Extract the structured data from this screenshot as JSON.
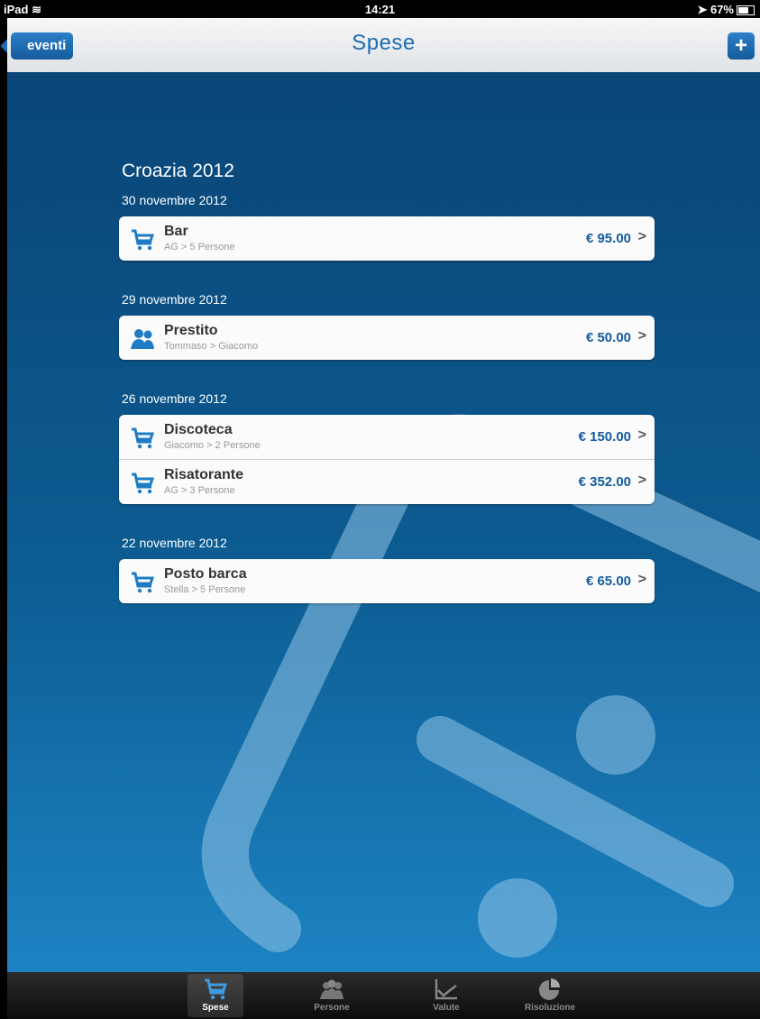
{
  "status_bar": {
    "device": "iPad",
    "time": "14:21",
    "battery": "67%"
  },
  "navbar": {
    "back_label": "eventi",
    "title": "Spese",
    "add_label": "+"
  },
  "event": {
    "title": "Croazia 2012"
  },
  "groups": [
    {
      "date": "30 novembre 2012",
      "items": [
        {
          "icon": "cart-icon",
          "name": "Bar",
          "sub": "AG > 5 Persone",
          "amount": "€ 95.00"
        }
      ]
    },
    {
      "date": "29 novembre 2012",
      "items": [
        {
          "icon": "people-transfer-icon",
          "name": "Prestito",
          "sub": "Tommaso > Giacomo",
          "amount": "€ 50.00"
        }
      ]
    },
    {
      "date": "26 novembre 2012",
      "items": [
        {
          "icon": "cart-icon",
          "name": "Discoteca",
          "sub": "Giacomo > 2 Persone",
          "amount": "€ 150.00"
        },
        {
          "icon": "cart-icon",
          "name": "Risatorante",
          "sub": "AG > 3 Persone",
          "amount": "€ 352.00"
        }
      ]
    },
    {
      "date": "22 novembre 2012",
      "items": [
        {
          "icon": "cart-icon",
          "name": "Posto barca",
          "sub": "Stella > 5 Persone",
          "amount": "€ 65.00"
        }
      ]
    }
  ],
  "tabs": [
    {
      "label": "Spese",
      "icon": "cart-icon",
      "active": true
    },
    {
      "label": "Persone",
      "icon": "people-icon",
      "active": false
    },
    {
      "label": "Valute",
      "icon": "chart-line-icon",
      "active": false
    },
    {
      "label": "Risoluzione",
      "icon": "pie-chart-icon",
      "active": false
    }
  ],
  "colors": {
    "accent": "#1f6db3",
    "amount": "#145c9f",
    "bg_top": "#0a4577",
    "bg_bottom": "#1d83c3"
  }
}
